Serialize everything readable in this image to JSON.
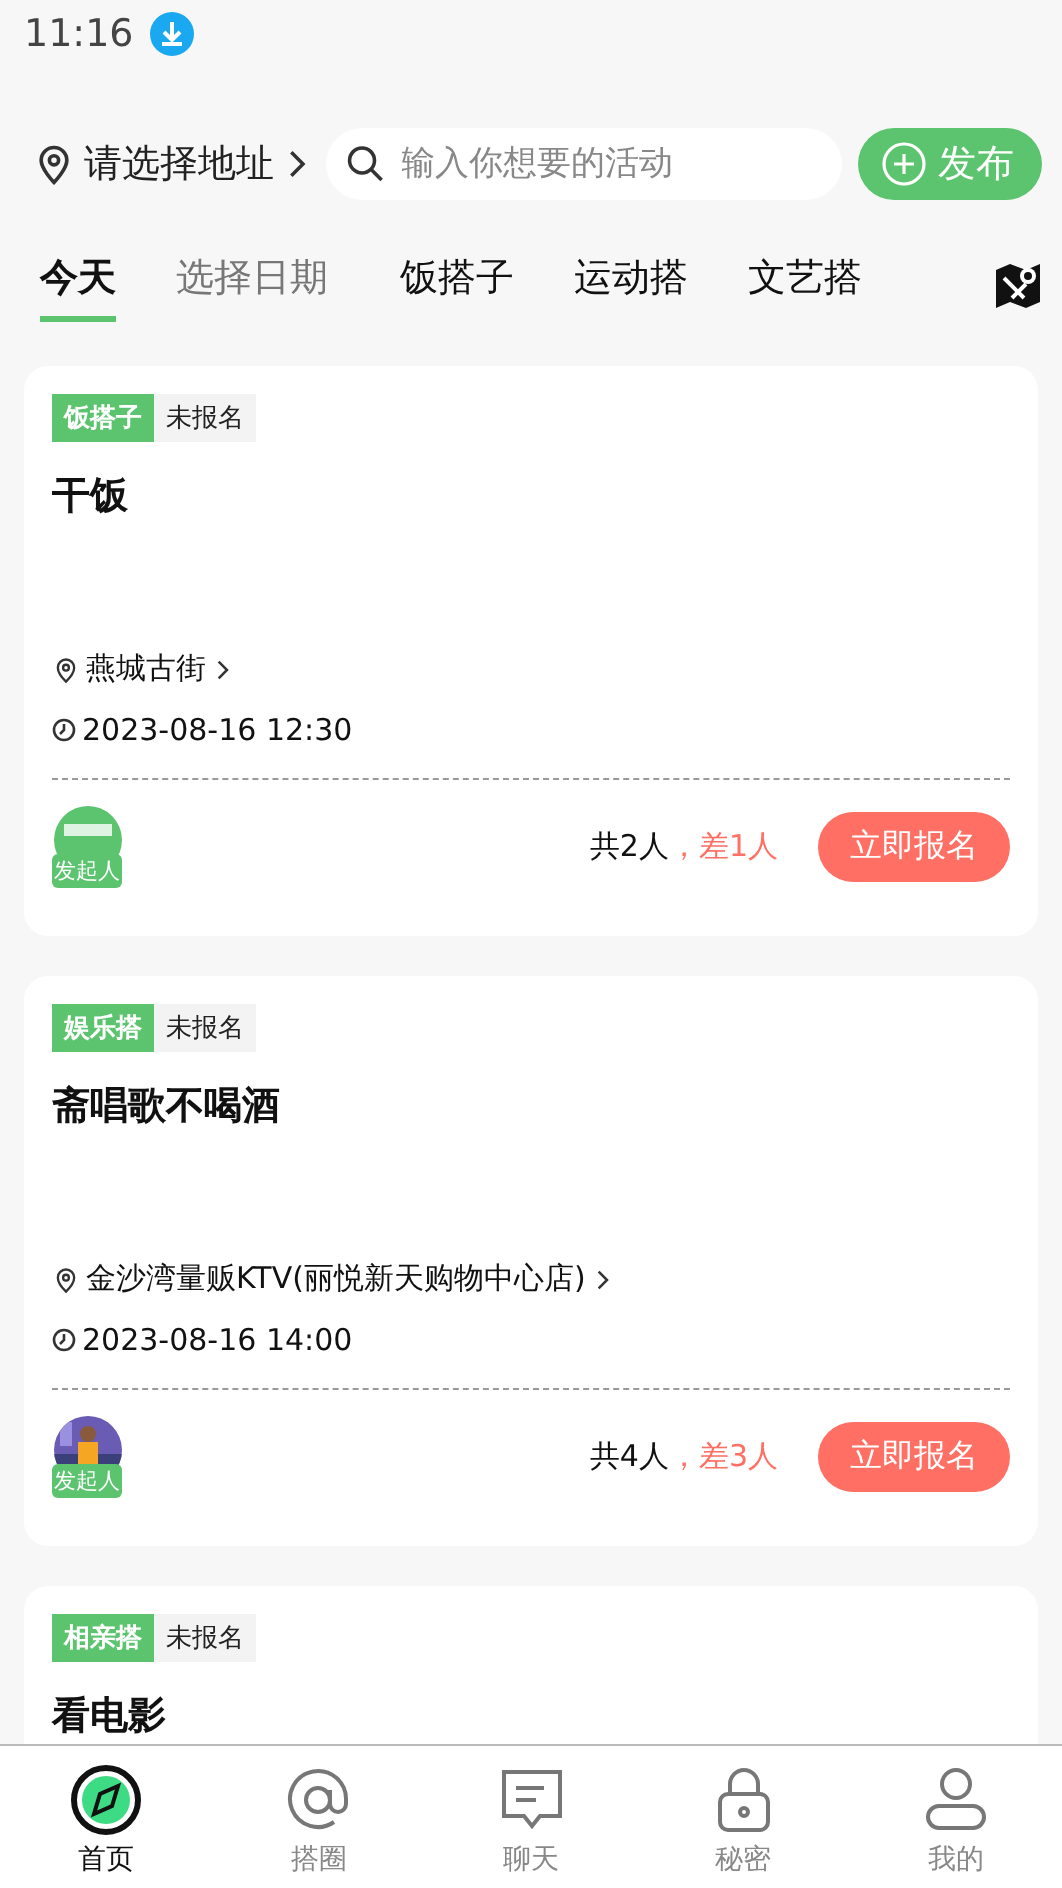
{
  "status_bar": {
    "time": "11:16"
  },
  "header": {
    "location": "请选择地址",
    "search": {
      "placeholder": "输入你想要的活动"
    },
    "publish": "发布"
  },
  "tabs": [
    {
      "label": "今天",
      "selected": true,
      "kind": "category"
    },
    {
      "label": "选择日期",
      "selected": false,
      "kind": "date"
    },
    {
      "label": "饭搭子",
      "selected": false,
      "kind": "category"
    },
    {
      "label": "运动搭",
      "selected": false,
      "kind": "category"
    },
    {
      "label": "文艺搭",
      "selected": false,
      "kind": "category"
    }
  ],
  "activities": [
    {
      "tag": "饭搭子",
      "status": "未报名",
      "title": "干饭",
      "place": "燕城古街",
      "time": "2023-08-16 12:30",
      "avatar_badge": "发起人",
      "total": "共2人",
      "missing": "，差1人",
      "join": "立即报名"
    },
    {
      "tag": "娱乐搭",
      "status": "未报名",
      "title": "斋唱歌不喝酒",
      "place": "金沙湾量贩KTV(丽悦新天购物中心店)",
      "time": "2023-08-16 14:00",
      "avatar_badge": "发起人",
      "total": "共4人",
      "missing": "，差3人",
      "join": "立即报名"
    },
    {
      "tag": "相亲搭",
      "status": "未报名",
      "title": "看电影"
    }
  ],
  "bottom_nav": [
    {
      "label": "首页",
      "selected": true
    },
    {
      "label": "搭圈",
      "selected": false
    },
    {
      "label": "聊天",
      "selected": false
    },
    {
      "label": "秘密",
      "selected": false
    },
    {
      "label": "我的",
      "selected": false
    }
  ]
}
